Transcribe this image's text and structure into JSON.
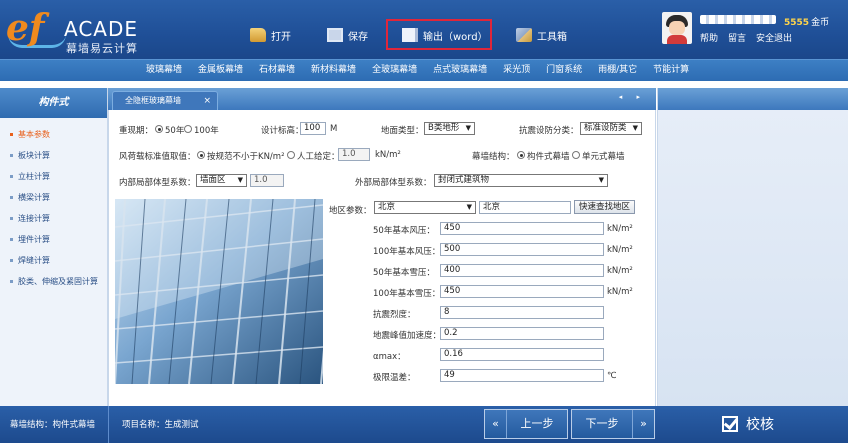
{
  "app": {
    "logo_mark": "ef",
    "logo_text": "ACADE",
    "logo_subtitle": "幕墙易云计算"
  },
  "toolbar": {
    "open_label": "打开",
    "save_label": "保存",
    "export_label": "输出（word）",
    "tools_label": "工具箱"
  },
  "user": {
    "coins_value": "5555",
    "coins_label": "金币",
    "links": [
      "帮助",
      "留言",
      "安全退出"
    ]
  },
  "menu": {
    "items": [
      "玻璃幕墙",
      "金属板幕墙",
      "石材幕墙",
      "新材料幕墙",
      "全玻璃幕墙",
      "点式玻璃幕墙",
      "采光顶",
      "门窗系统",
      "雨棚/其它",
      "节能计算"
    ]
  },
  "sidebar": {
    "title": "构件式",
    "items": [
      {
        "label": "基本参数",
        "active": true
      },
      {
        "label": "板块计算",
        "active": false
      },
      {
        "label": "立柱计算",
        "active": false
      },
      {
        "label": "横梁计算",
        "active": false
      },
      {
        "label": "连接计算",
        "active": false
      },
      {
        "label": "埋件计算",
        "active": false
      },
      {
        "label": "焊缝计算",
        "active": false
      },
      {
        "label": "胶类、伸缩及紧固计算",
        "active": false
      }
    ]
  },
  "tab": {
    "label": "全隐框玻璃幕墙",
    "close": "×",
    "nav": "◂ ▸"
  },
  "form": {
    "return_period_label": "重现期：",
    "return_period_options": [
      "50年",
      "100年"
    ],
    "return_period_selected": "50年",
    "design_height_label": "设计标高：",
    "design_height_value": "100",
    "design_height_unit": "M",
    "terrain_label": "地面类型：",
    "terrain_value": "B类地形",
    "seismic_label": "抗震设防分类：",
    "seismic_value": "标准设防类",
    "wind_std_label": "风荷载标准值取值：",
    "wind_std_options": [
      "按规范不小于KN/m²",
      "人工给定："
    ],
    "wind_std_selected": "按规范不小于KN/m²",
    "wind_std_manual_value": "1.0",
    "wind_std_unit": "kN/m²",
    "curtain_structure_label": "幕墙结构：",
    "curtain_structure_options": [
      "构件式幕墙",
      "单元式幕墙"
    ],
    "curtain_structure_selected": "构件式幕墙",
    "inner_shape_label": "内部局部体型系数：",
    "inner_shape_value": "墙面区",
    "inner_shape_number": "1.0",
    "outer_shape_label": "外部局部体型系数：",
    "outer_shape_value": "封闭式建筑物",
    "region_label": "地区参数：",
    "region_select": "北京",
    "region_text": "北京",
    "find_region_button": "快速查找地区",
    "params": [
      {
        "label": "50年基本风压：",
        "value": "450",
        "unit": "kN/m²"
      },
      {
        "label": "100年基本风压：",
        "value": "500",
        "unit": "kN/m²"
      },
      {
        "label": "50年基本雪压：",
        "value": "400",
        "unit": "kN/m²"
      },
      {
        "label": "100年基本雪压：",
        "value": "450",
        "unit": "kN/m²"
      },
      {
        "label": "抗震烈度：",
        "value": "8",
        "unit": ""
      },
      {
        "label": "地震峰值加速度：",
        "value": "0.2",
        "unit": ""
      },
      {
        "label": "αmax：",
        "value": "0.16",
        "unit": ""
      },
      {
        "label": "极限温差：",
        "value": "49",
        "unit": "℃"
      }
    ]
  },
  "footer": {
    "structure_text": "幕墙结构：构件式幕墙",
    "project_text": "项目名称：生成测试",
    "prev_label": "上一步",
    "next_label": "下一步",
    "prev_chevron": "«",
    "next_chevron": "»",
    "verify_label": "校核"
  },
  "colors": {
    "header_blue": "#1f4f97",
    "menu_blue": "#2d6cb3",
    "export_highlight": "#e0263a",
    "active_sidebar": "#e8601c"
  }
}
